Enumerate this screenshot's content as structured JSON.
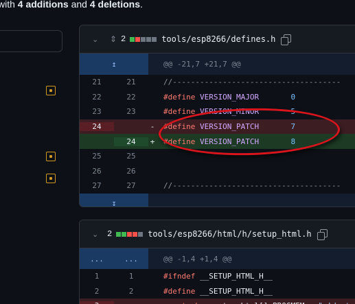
{
  "summary": {
    "prefix": "with ",
    "additions": "4 additions",
    "mid": " and ",
    "deletions": "4 deletions",
    "suffix": "."
  },
  "icons": {
    "comment": "comment-icon",
    "colors": {
      "comment": "#d29922",
      "add": "#3fb950",
      "del": "#f85149",
      "neutral": "#6e7681"
    }
  },
  "file1": {
    "changes": "2",
    "name": "tools/esp8266/defines.h",
    "blocks": [
      "add",
      "del",
      "neutral",
      "neutral",
      "neutral"
    ],
    "hunk": "@@ -21,7 +21,7 @@",
    "rows": [
      {
        "old": "21",
        "new": "21",
        "type": "ctx",
        "marker": "",
        "parts": [
          {
            "c": "cm",
            "t": "//-------------------------------------"
          }
        ]
      },
      {
        "old": "22",
        "new": "22",
        "type": "ctx",
        "marker": "",
        "parts": [
          {
            "c": "kw",
            "t": "#define"
          },
          {
            "c": "",
            "t": " "
          },
          {
            "c": "mc",
            "t": "VERSION_MAJOR"
          },
          {
            "c": "",
            "t": "       "
          },
          {
            "c": "num",
            "t": "0"
          }
        ]
      },
      {
        "old": "23",
        "new": "23",
        "type": "ctx",
        "marker": "",
        "parts": [
          {
            "c": "kw",
            "t": "#define"
          },
          {
            "c": "",
            "t": " "
          },
          {
            "c": "mc",
            "t": "VERSION_MINOR"
          },
          {
            "c": "",
            "t": "       "
          },
          {
            "c": "num",
            "t": "5"
          }
        ]
      },
      {
        "old": "24",
        "new": "",
        "type": "del",
        "marker": "-",
        "parts": [
          {
            "c": "kw",
            "t": "#define"
          },
          {
            "c": "",
            "t": " "
          },
          {
            "c": "mc",
            "t": "VERSION_PATCH"
          },
          {
            "c": "",
            "t": "       "
          },
          {
            "c": "num",
            "t": "7"
          }
        ]
      },
      {
        "old": "",
        "new": "24",
        "type": "add",
        "marker": "+",
        "parts": [
          {
            "c": "kw",
            "t": "#define"
          },
          {
            "c": "",
            "t": " "
          },
          {
            "c": "mc",
            "t": "VERSION_PATCH"
          },
          {
            "c": "",
            "t": "       "
          },
          {
            "c": "num",
            "t": "8"
          }
        ]
      },
      {
        "old": "25",
        "new": "25",
        "type": "ctx",
        "marker": "",
        "parts": []
      },
      {
        "old": "26",
        "new": "26",
        "type": "ctx",
        "marker": "",
        "parts": []
      },
      {
        "old": "27",
        "new": "27",
        "type": "ctx",
        "marker": "",
        "parts": [
          {
            "c": "cm",
            "t": "//-------------------------------------"
          }
        ]
      }
    ]
  },
  "file2": {
    "changes": "2",
    "name": "tools/esp8266/html/h/setup_html.h",
    "blocks": [
      "add",
      "add",
      "del",
      "del",
      "neutral"
    ],
    "hunk": "@@ -1,4 +1,4 @@",
    "hunk_gutter": [
      "...",
      "..."
    ],
    "rows": [
      {
        "old": "1",
        "new": "1",
        "type": "ctx",
        "marker": "",
        "parts": [
          {
            "c": "kw",
            "t": "#ifndef"
          },
          {
            "c": "",
            "t": " "
          },
          {
            "c": "",
            "t": "__SETUP_HTML_H__"
          }
        ]
      },
      {
        "old": "2",
        "new": "2",
        "type": "ctx",
        "marker": "",
        "parts": [
          {
            "c": "kw",
            "t": "#define"
          },
          {
            "c": "",
            "t": " "
          },
          {
            "c": "",
            "t": "__SETUP_HTML_H__"
          }
        ]
      },
      {
        "old": "3",
        "new": "",
        "type": "del",
        "marker": "-",
        "parts": [
          {
            "c": "kw",
            "t": "const"
          },
          {
            "c": "",
            "t": " "
          },
          {
            "c": "kw",
            "t": "char"
          },
          {
            "c": "",
            "t": " setup_html[] PROGMEM = "
          },
          {
            "c": "str",
            "t": "\"<!doctype"
          }
        ]
      }
    ]
  }
}
